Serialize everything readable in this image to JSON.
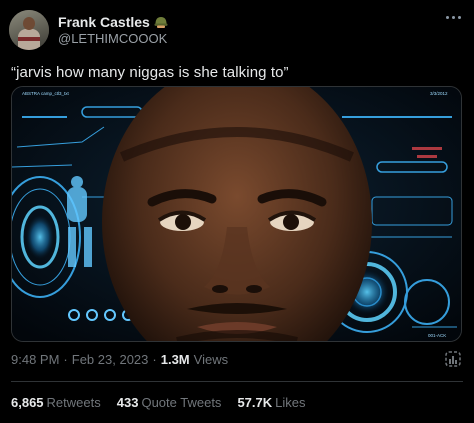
{
  "author": {
    "display_name": "Frank Castles",
    "name_emoji": "military-helmet-emoji",
    "handle": "@LETHIMCOOOK",
    "avatar": "profile-avatar"
  },
  "tweet": {
    "text": "“jarvis how many niggas is she talking to”",
    "media": {
      "description_icon": "holographic-hud-face-image",
      "small_top_left": "ABSTRA camp_ctl3_txt",
      "small_top_right": "3/3/2012",
      "small_bottom_right": "001-ACK"
    }
  },
  "meta": {
    "time": "9:48 PM",
    "separator": "·",
    "date": "Feb 23, 2023",
    "separator2": "·",
    "views_count": "1.3M",
    "views_label": "Views"
  },
  "stats": {
    "retweets_count": "6,865",
    "retweets_label": "Retweets",
    "quotes_count": "433",
    "quotes_label": "Quote Tweets",
    "likes_count": "57.7K",
    "likes_label": "Likes"
  },
  "colors": {
    "background": "#000000",
    "primary_text": "#e7e9ea",
    "secondary_text": "#71767b",
    "divider": "#2f3336",
    "hud_accent": "#3fb8ff"
  }
}
